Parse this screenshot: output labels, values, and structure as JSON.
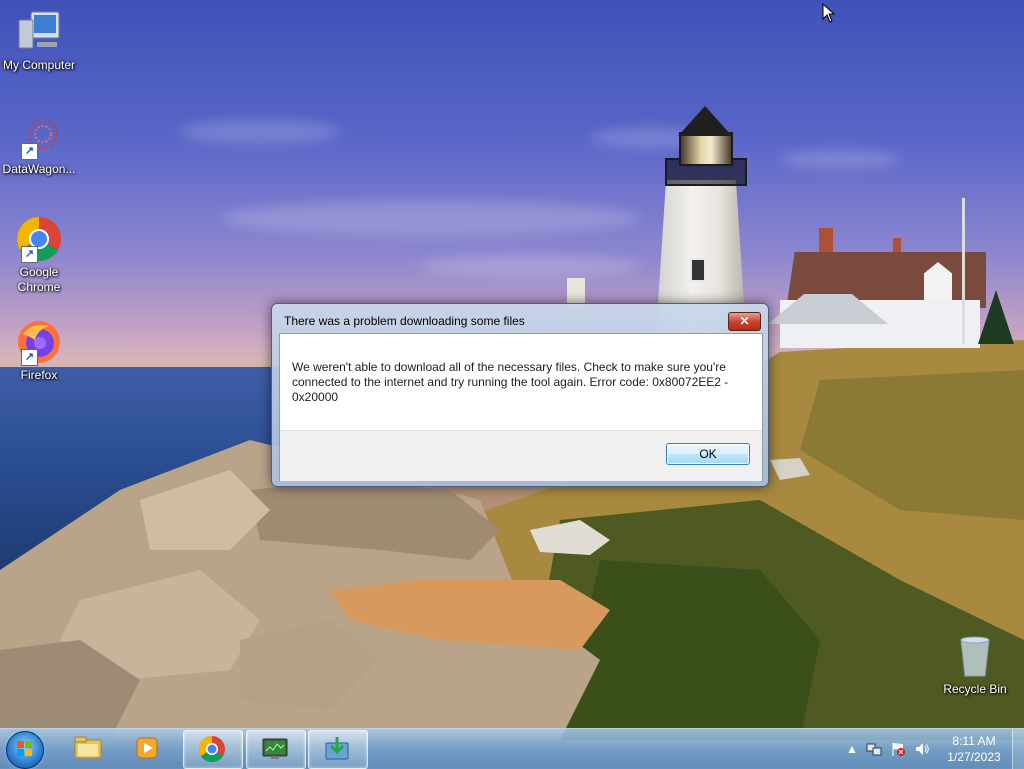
{
  "desktop": {
    "icons": [
      {
        "label": "My Computer",
        "icon": "computer-icon"
      },
      {
        "label": "DataWagon...",
        "icon": "datawagon-icon"
      },
      {
        "label": "Google\nChrome",
        "icon": "chrome-icon"
      },
      {
        "label": "Firefox",
        "icon": "firefox-icon"
      },
      {
        "label": "Recycle Bin",
        "icon": "recycle-bin-icon"
      }
    ]
  },
  "dialog": {
    "title": "There was a problem downloading some files",
    "close_label": "✕",
    "message": "We weren't able to download all of the necessary files. Check to make sure you're connected to the internet and try running the tool again. Error code: 0x80072EE2 - 0x20000",
    "ok_label": "OK"
  },
  "taskbar": {
    "items": [
      {
        "name": "Windows Explorer",
        "icon": "folder-icon"
      },
      {
        "name": "Windows Media Player",
        "icon": "media-player-icon"
      },
      {
        "name": "Google Chrome",
        "icon": "chrome-icon"
      },
      {
        "name": "Task Manager",
        "icon": "monitor-icon"
      },
      {
        "name": "Media Creation Tool",
        "icon": "download-icon"
      }
    ],
    "tray": {
      "show_hidden": "▲",
      "time": "8:11 AM",
      "date": "1/27/2023"
    }
  },
  "colors": {
    "accent": "#3c7fb1",
    "close": "#c8452f"
  }
}
